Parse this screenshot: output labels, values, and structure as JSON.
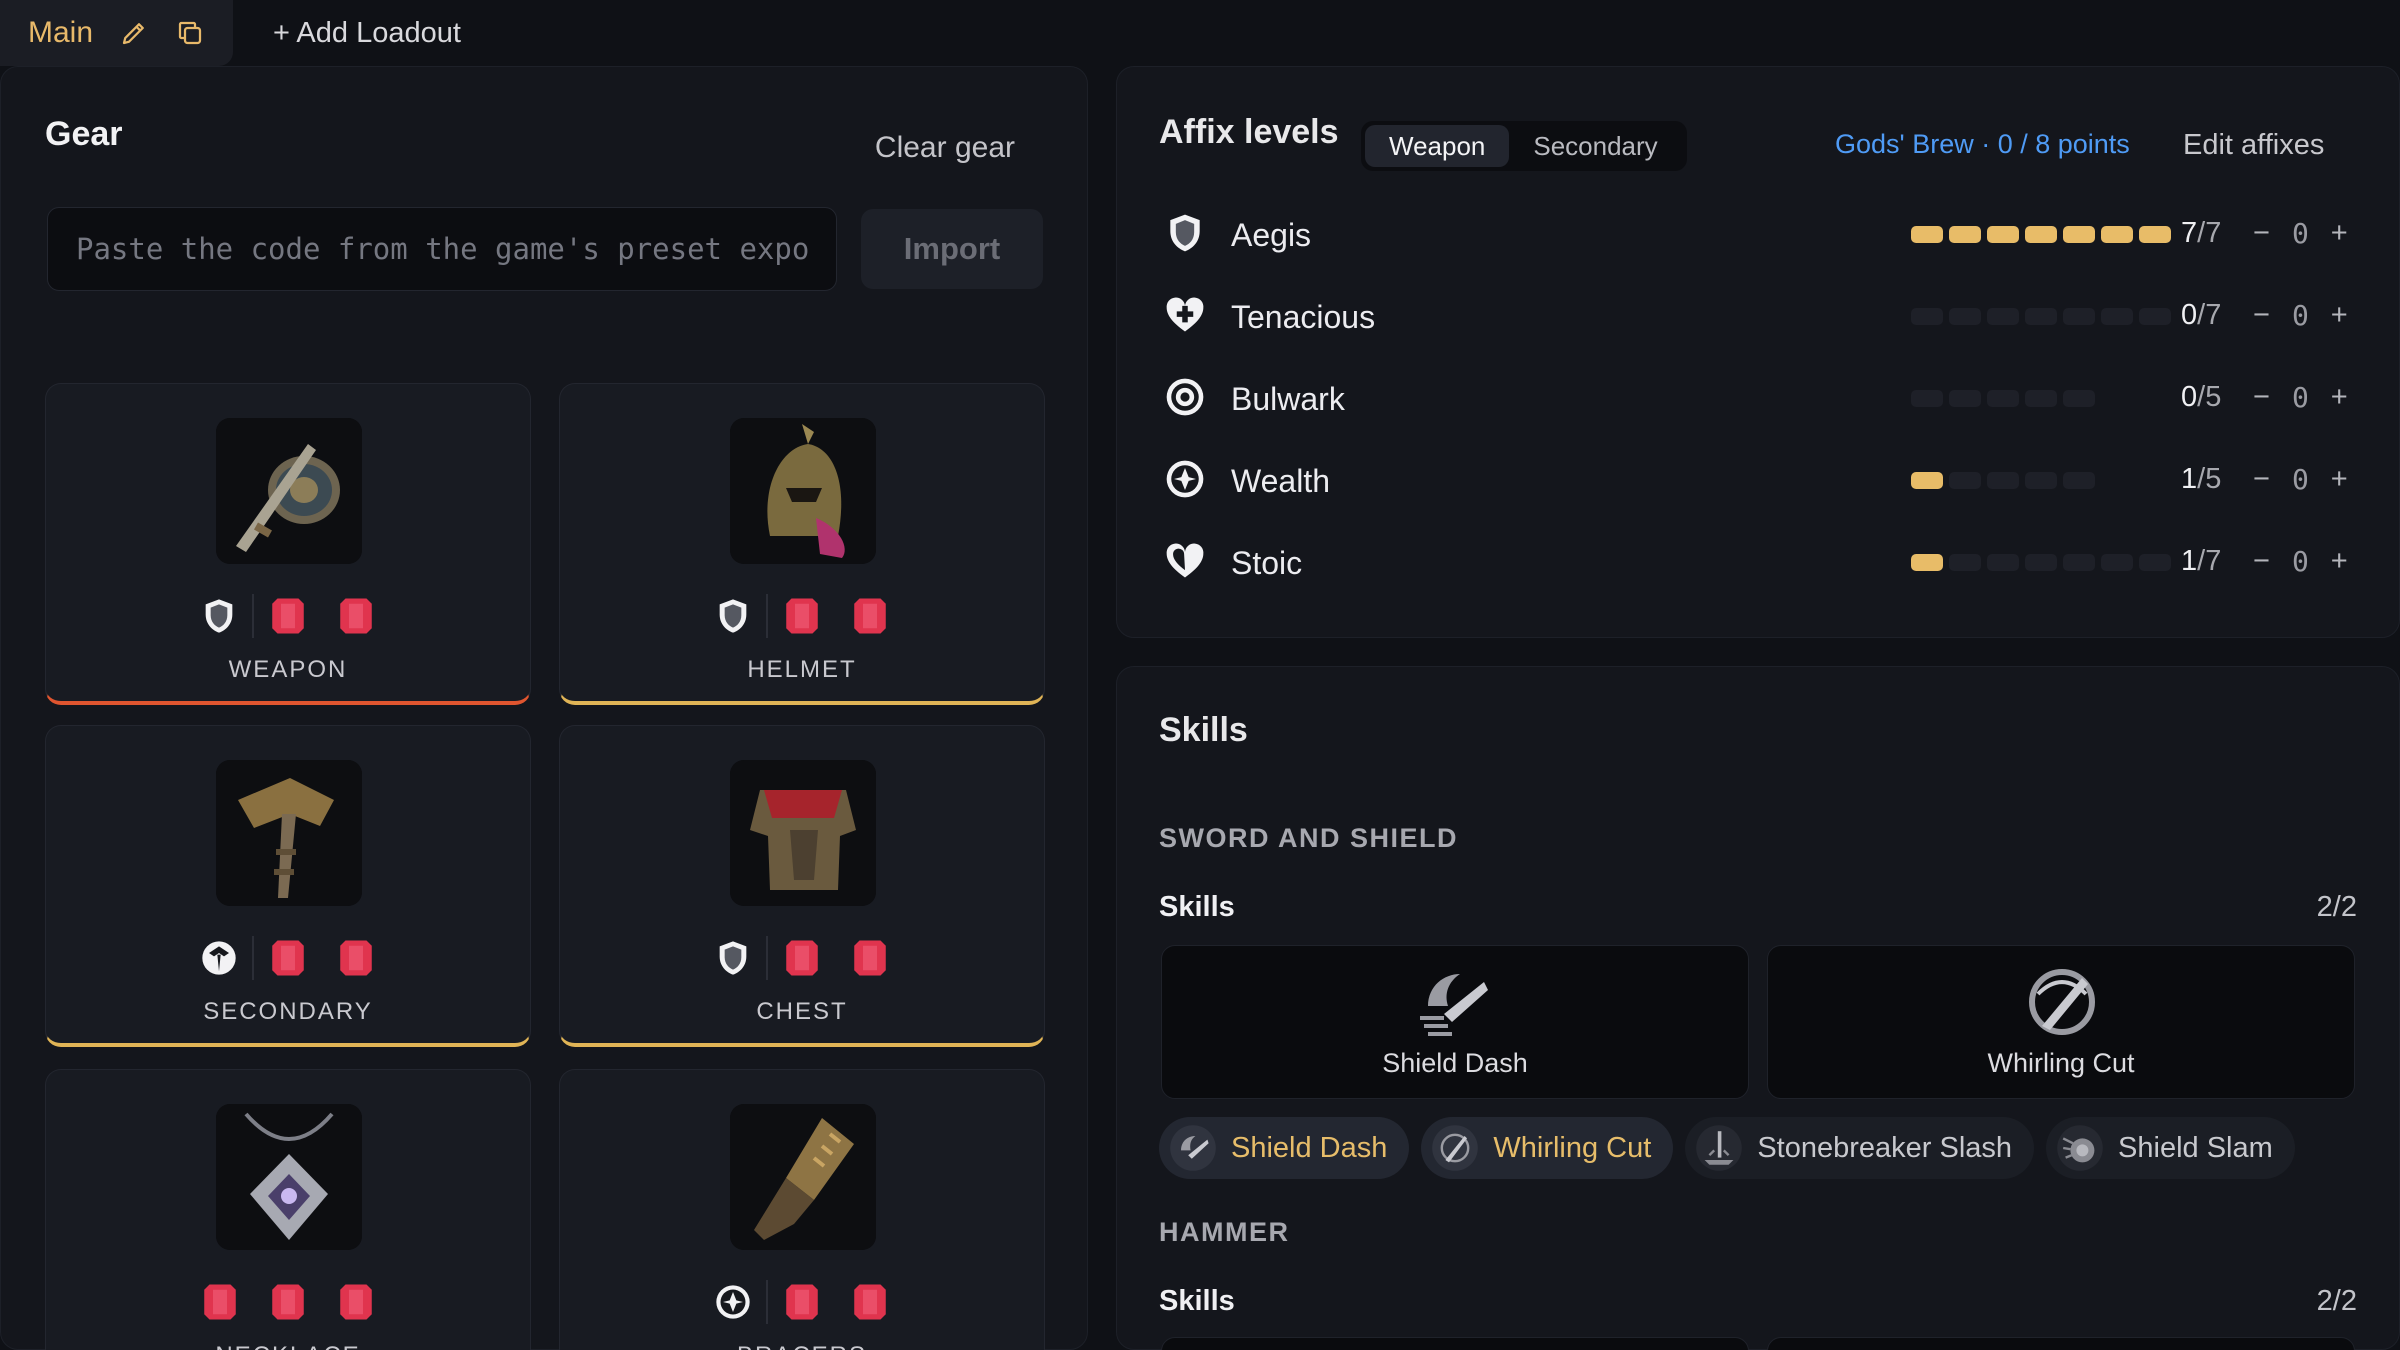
{
  "topbar": {
    "main_tab": "Main",
    "add_loadout": "+ Add Loadout"
  },
  "gear": {
    "title": "Gear",
    "clear_label": "Clear gear",
    "code_placeholder": "Paste the code from the game's preset export",
    "import_label": "Import",
    "slots": [
      {
        "label": "WEAPON",
        "affix_icon": "shield-icon",
        "accent": "#e0552f"
      },
      {
        "label": "HELMET",
        "affix_icon": "shield-icon",
        "accent": "#e0b456"
      },
      {
        "label": "SECONDARY",
        "affix_icon": "hammer-crest-icon",
        "accent": "#e0b456"
      },
      {
        "label": "CHEST",
        "affix_icon": "shield-icon",
        "accent": "#e0b456"
      },
      {
        "label": "NECKLACE",
        "affix_icon": "ruby-gem-icon",
        "accent": "#e0b456"
      },
      {
        "label": "BRACERS",
        "affix_icon": "wealth-icon",
        "accent": "#e0b456"
      }
    ]
  },
  "affix": {
    "title": "Affix levels",
    "tabs": [
      "Weapon",
      "Secondary"
    ],
    "active_tab": "Weapon",
    "gods_brew": "Gods' Brew · 0 / 8 points",
    "edit_label": "Edit affixes",
    "rows": [
      {
        "name": "Aegis",
        "current": "7",
        "max": "/7",
        "filled": 7,
        "total": 7,
        "value": "0",
        "icon": "shield-icon"
      },
      {
        "name": "Tenacious",
        "current": "0",
        "max": "/7",
        "filled": 0,
        "total": 7,
        "value": "0",
        "icon": "heart-cross-icon"
      },
      {
        "name": "Bulwark",
        "current": "0",
        "max": "/5",
        "filled": 0,
        "total": 5,
        "value": "0",
        "icon": "target-icon"
      },
      {
        "name": "Wealth",
        "current": "1",
        "max": "/5",
        "filled": 1,
        "total": 5,
        "value": "0",
        "icon": "wealth-icon"
      },
      {
        "name": "Stoic",
        "current": "1",
        "max": "/7",
        "filled": 1,
        "total": 7,
        "value": "0",
        "icon": "heart-icon"
      }
    ],
    "minus": "−",
    "plus": "+"
  },
  "skills": {
    "title": "Skills",
    "groups": [
      {
        "heading": "SWORD AND SHIELD",
        "sub": "Skills",
        "count": "2/2",
        "cards": [
          "Shield Dash",
          "Whirling Cut"
        ],
        "chips": [
          {
            "label": "Shield Dash",
            "selected": true
          },
          {
            "label": "Whirling Cut",
            "selected": true
          },
          {
            "label": "Stonebreaker Slash",
            "selected": false
          },
          {
            "label": "Shield Slam",
            "selected": false
          }
        ]
      },
      {
        "heading": "HAMMER",
        "sub": "Skills",
        "count": "2/2"
      }
    ]
  },
  "colors": {
    "gold": "#e8bc68",
    "blue_link": "#4f9bf5",
    "ruby": "#e0344e",
    "weapon_accent": "#e0552f"
  }
}
